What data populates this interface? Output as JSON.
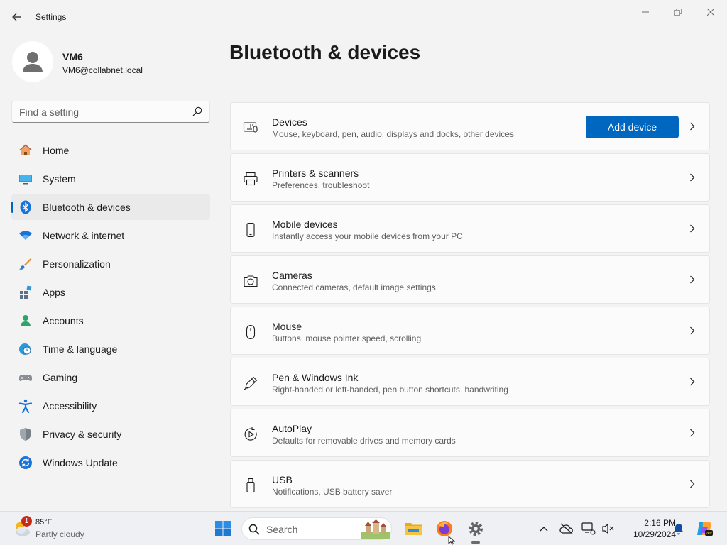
{
  "window": {
    "app_title": "Settings",
    "controls": [
      "minimize",
      "restore",
      "close"
    ]
  },
  "profile": {
    "name": "VM6",
    "email": "VM6@collabnet.local"
  },
  "search": {
    "placeholder": "Find a setting"
  },
  "sidebar": {
    "items": [
      {
        "label": "Home",
        "icon": "home-icon"
      },
      {
        "label": "System",
        "icon": "monitor-icon"
      },
      {
        "label": "Bluetooth & devices",
        "icon": "bluetooth-icon",
        "active": true
      },
      {
        "label": "Network & internet",
        "icon": "wifi-icon"
      },
      {
        "label": "Personalization",
        "icon": "brush-icon"
      },
      {
        "label": "Apps",
        "icon": "apps-icon"
      },
      {
        "label": "Accounts",
        "icon": "person-icon"
      },
      {
        "label": "Time & language",
        "icon": "clock-globe-icon"
      },
      {
        "label": "Gaming",
        "icon": "gamepad-icon"
      },
      {
        "label": "Accessibility",
        "icon": "accessibility-icon"
      },
      {
        "label": "Privacy & security",
        "icon": "shield-icon"
      },
      {
        "label": "Windows Update",
        "icon": "update-icon"
      }
    ]
  },
  "main": {
    "title": "Bluetooth & devices",
    "cards": [
      {
        "title": "Devices",
        "desc": "Mouse, keyboard, pen, audio, displays and docks, other devices",
        "icon": "devices-icon",
        "button": "Add device"
      },
      {
        "title": "Printers & scanners",
        "desc": "Preferences, troubleshoot",
        "icon": "printer-icon"
      },
      {
        "title": "Mobile devices",
        "desc": "Instantly access your mobile devices from your PC",
        "icon": "phone-icon"
      },
      {
        "title": "Cameras",
        "desc": "Connected cameras, default image settings",
        "icon": "camera-icon"
      },
      {
        "title": "Mouse",
        "desc": "Buttons, mouse pointer speed, scrolling",
        "icon": "mouse-icon"
      },
      {
        "title": "Pen & Windows Ink",
        "desc": "Right-handed or left-handed, pen button shortcuts, handwriting",
        "icon": "pen-icon"
      },
      {
        "title": "AutoPlay",
        "desc": "Defaults for removable drives and memory cards",
        "icon": "autoplay-icon"
      },
      {
        "title": "USB",
        "desc": "Notifications, USB battery saver",
        "icon": "usb-icon"
      }
    ]
  },
  "taskbar": {
    "weather": {
      "temp": "85°F",
      "desc": "Partly cloudy",
      "badge": "1"
    },
    "search_label": "Search",
    "time": "2:16 PM",
    "date": "10/29/2024"
  },
  "colors": {
    "accent": "#0067c0",
    "background": "#f3f3f3",
    "card": "#fbfbfb"
  }
}
